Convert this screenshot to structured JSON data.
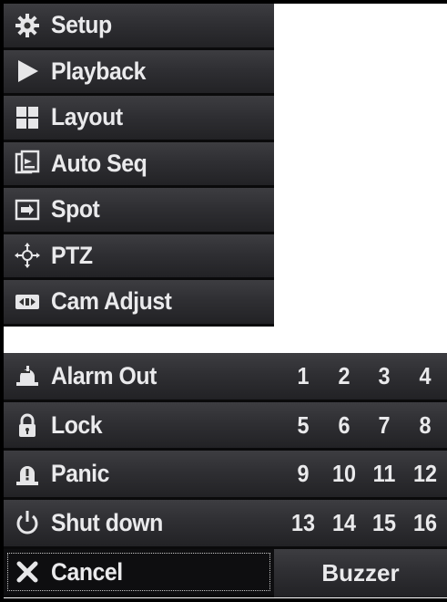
{
  "menu": {
    "items": [
      {
        "label": "Setup",
        "icon": "gear-icon"
      },
      {
        "label": "Playback",
        "icon": "play-icon"
      },
      {
        "label": "Layout",
        "icon": "grid-icon"
      },
      {
        "label": "Auto Seq",
        "icon": "auto-sequence-icon"
      },
      {
        "label": "Spot",
        "icon": "spot-icon"
      },
      {
        "label": "PTZ",
        "icon": "ptz-icon"
      },
      {
        "label": "Cam Adjust",
        "icon": "camera-adjust-icon"
      }
    ]
  },
  "lower": {
    "rows": [
      {
        "label": "Alarm Out",
        "icon": "alarm-out-icon",
        "numbers": [
          "1",
          "2",
          "3",
          "4"
        ]
      },
      {
        "label": "Lock",
        "icon": "lock-icon",
        "numbers": [
          "5",
          "6",
          "7",
          "8"
        ]
      },
      {
        "label": "Panic",
        "icon": "panic-icon",
        "numbers": [
          "9",
          "10",
          "11",
          "12"
        ]
      },
      {
        "label": "Shut down",
        "icon": "power-icon",
        "numbers": [
          "13",
          "14",
          "15",
          "16"
        ]
      }
    ],
    "cancel": {
      "label": "Cancel",
      "icon": "close-icon"
    },
    "buzzer": {
      "label": "Buzzer"
    }
  },
  "colors": {
    "text": "#eaeaec",
    "item_top": "#3d3d41",
    "item_bottom": "#222225",
    "separator": "#0a0a0b"
  }
}
